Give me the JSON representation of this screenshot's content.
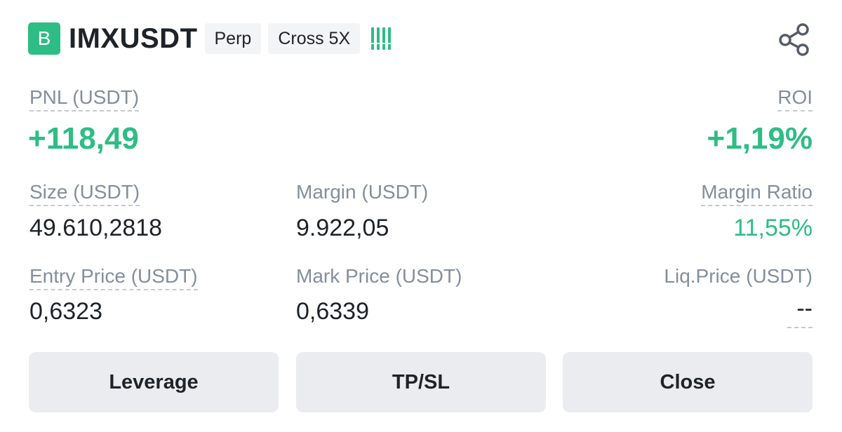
{
  "header": {
    "side_badge": "B",
    "symbol": "IMXUSDT",
    "type_tag": "Perp",
    "margin_tag": "Cross 5X",
    "risk_level_bars": 4,
    "share_icon": "share-icon"
  },
  "pnl": {
    "label": "PNL (USDT)",
    "value": "+118,49"
  },
  "roi": {
    "label": "ROI",
    "value": "+1,19%"
  },
  "size": {
    "label": "Size (USDT)",
    "value": "49.610,2818"
  },
  "margin": {
    "label": "Margin (USDT)",
    "value": "9.922,05"
  },
  "margin_ratio": {
    "label": "Margin Ratio",
    "value": "11,55%"
  },
  "entry_price": {
    "label": "Entry Price (USDT)",
    "value": "0,6323"
  },
  "mark_price": {
    "label": "Mark Price (USDT)",
    "value": "0,6339"
  },
  "liq_price": {
    "label": "Liq.Price (USDT)",
    "value": "--"
  },
  "buttons": {
    "leverage": "Leverage",
    "tpsl": "TP/SL",
    "close": "Close"
  },
  "colors": {
    "green": "#2ebd85",
    "label_gray": "#848e9c",
    "button_bg": "#eaecef",
    "tag_bg": "#f3f4f5"
  }
}
